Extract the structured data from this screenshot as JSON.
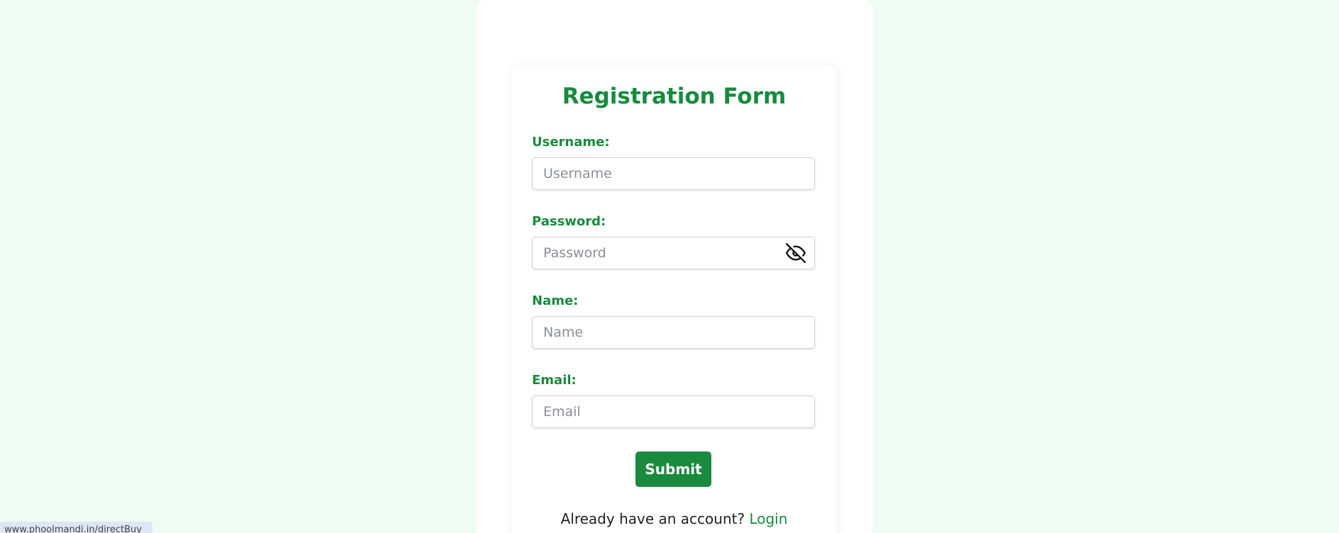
{
  "form": {
    "title": "Registration Form",
    "username": {
      "label": "Username:",
      "placeholder": "Username",
      "value": ""
    },
    "password": {
      "label": "Password:",
      "placeholder": "Password",
      "value": "",
      "toggle_icon": "eye-slash-icon"
    },
    "name": {
      "label": "Name:",
      "placeholder": "Name",
      "value": ""
    },
    "email": {
      "label": "Email:",
      "placeholder": "Email",
      "value": ""
    },
    "submit_label": "Submit",
    "login_prompt": "Already have an account?",
    "login_link": "Login"
  },
  "status_bar": {
    "url": "www.phoolmandi.in/directBuy"
  },
  "colors": {
    "accent": "#1a8a3e",
    "background": "#effcf3"
  }
}
